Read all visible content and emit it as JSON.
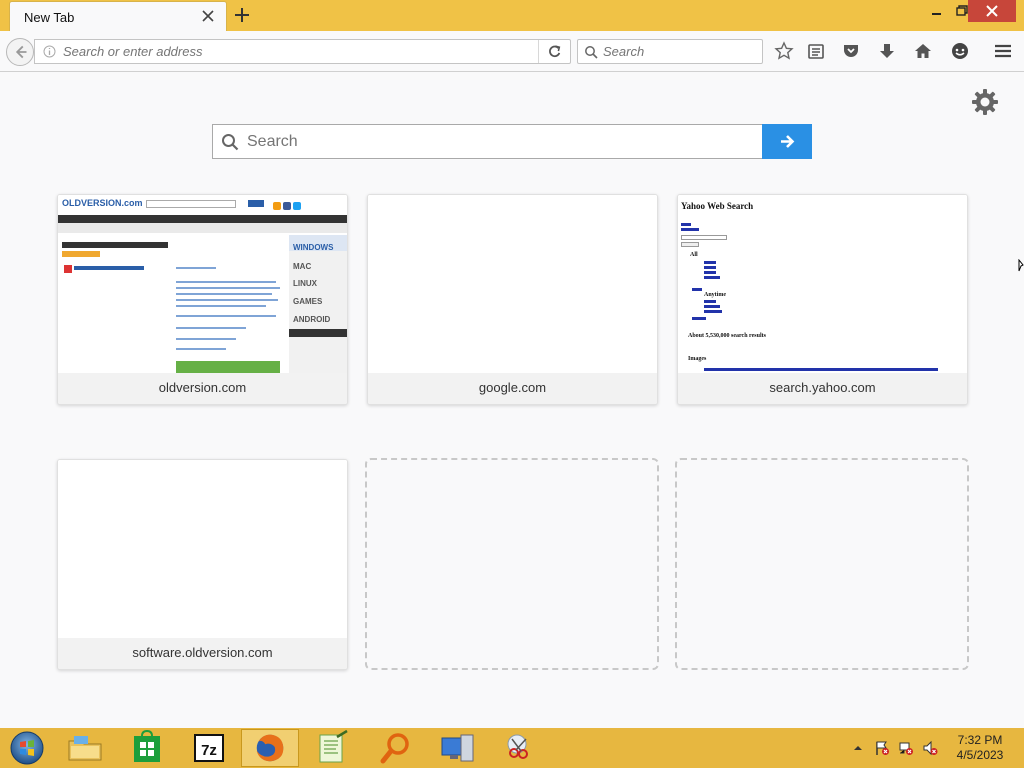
{
  "browser": {
    "tab": {
      "title": "New Tab"
    },
    "address_bar": {
      "placeholder": "Search or enter address"
    },
    "search_bar": {
      "placeholder": "Search"
    }
  },
  "newtab_page": {
    "search": {
      "placeholder": "Search"
    },
    "tiles": [
      {
        "label": "oldversion.com"
      },
      {
        "label": "google.com"
      },
      {
        "label": "search.yahoo.com"
      },
      {
        "label": "software.oldversion.com"
      }
    ],
    "oldversion_thumb": {
      "logo": "OLDVERSION.com",
      "os_items": [
        "WINDOWS",
        "MAC",
        "LINUX",
        "GAMES",
        "ANDROID"
      ]
    },
    "yahoo_thumb": {
      "title": "Yahoo Web Search",
      "results": "About 5,530,000 search results",
      "images": "Images",
      "filter_all": "All",
      "filter_anytime": "Anytime"
    }
  },
  "taskbar": {
    "apps": [
      "file-explorer",
      "store",
      "7-zip",
      "firefox",
      "notepad-plus-plus",
      "search-app",
      "remote-desktop",
      "snipping-tool"
    ],
    "clock": {
      "time": "7:32 PM",
      "date": "4/5/2023"
    }
  },
  "colors": {
    "titlebar": "#f0c246",
    "taskbar": "#e7b740",
    "accent_blue": "#2a90e4",
    "close_red": "#c7463a"
  }
}
